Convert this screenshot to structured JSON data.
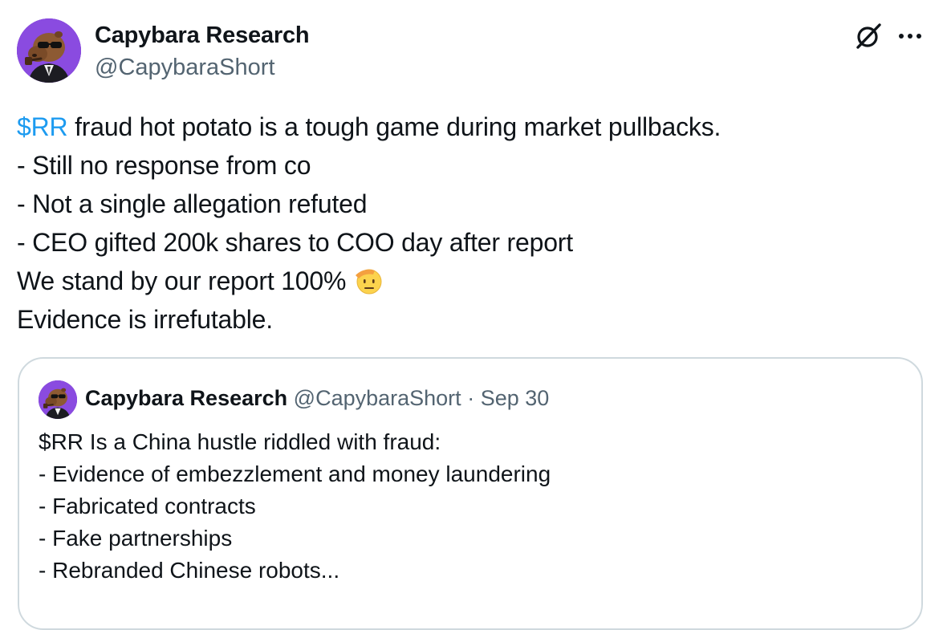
{
  "author": {
    "name": "Capybara Research",
    "handle": "@CapybaraShort",
    "avatar_icon": "capybara-with-sunglasses-avatar"
  },
  "actions": {
    "grok_icon": "grok-icon",
    "more_icon": "more-dots-icon"
  },
  "tweet": {
    "lines": [
      {
        "cashtag": "$RR",
        "text": " fraud hot potato is a tough game during market pullbacks."
      },
      {
        "text": "- Still no response from co"
      },
      {
        "text": "- Not a single allegation refuted"
      },
      {
        "text": "- CEO gifted 200k shares to COO day after report"
      },
      {
        "text": "We stand by our report 100%",
        "emoji": "saluting-face-emoji"
      },
      {
        "text": "Evidence is irrefutable."
      }
    ]
  },
  "quote": {
    "name": "Capybara Research",
    "handle": "@CapybaraShort",
    "separator": "·",
    "date": "Sep 30",
    "lines": [
      "$RR Is a China hustle riddled with fraud:",
      "- Evidence of embezzlement and money laundering",
      "- Fabricated contracts",
      "- Fake partnerships",
      "- Rebranded Chinese robots..."
    ]
  },
  "colors": {
    "accent": "#1d9bf0",
    "text": "#0f1419",
    "secondary": "#536471",
    "border": "#cfd9de",
    "avatar_bg": "#7b3fd0"
  }
}
